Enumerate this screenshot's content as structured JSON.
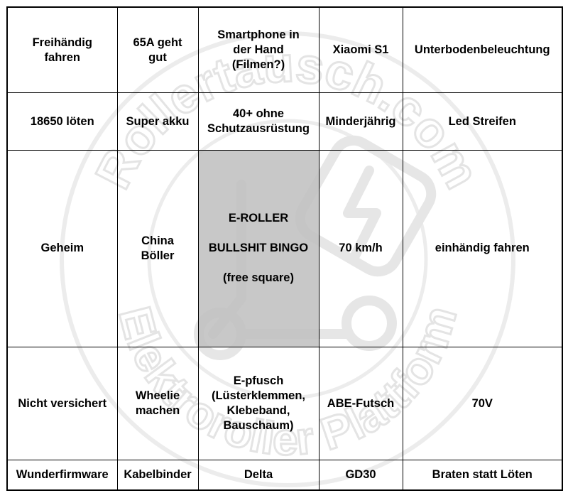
{
  "watermark": {
    "top_text": "Rollertausch.com",
    "bottom_text": "Elektroroller Plattform",
    "icon": "scooter-lightning-icon",
    "color": "#e6e6e6"
  },
  "free_square": {
    "line1": "E-ROLLER",
    "line2": "BULLSHIT BINGO",
    "line3": "(free square)",
    "color": "#c0c0c0"
  },
  "rows": [
    [
      "Freihändig\nfahren",
      "65A geht\ngut",
      "Smartphone in\nder Hand\n(Filmen?)",
      "Xiaomi S1",
      "Unterbodenbeleuchtung"
    ],
    [
      "18650 löten",
      "Super akku",
      "40+ ohne\nSchutzausrüstung",
      "Minderjährig",
      "Led Streifen"
    ],
    [
      "Geheim",
      "China\nBöller",
      "",
      "70 km/h",
      "einhändig fahren"
    ],
    [
      "Nicht versichert",
      "Wheelie\nmachen",
      "E-pfusch\n(Lüsterklemmen,\nKlebeband,\nBauschaum)",
      "ABE-Futsch",
      "70V"
    ],
    [
      "Wunderfirmware",
      "Kabelbinder",
      "Delta",
      "GD30",
      "Braten statt Löten"
    ]
  ]
}
